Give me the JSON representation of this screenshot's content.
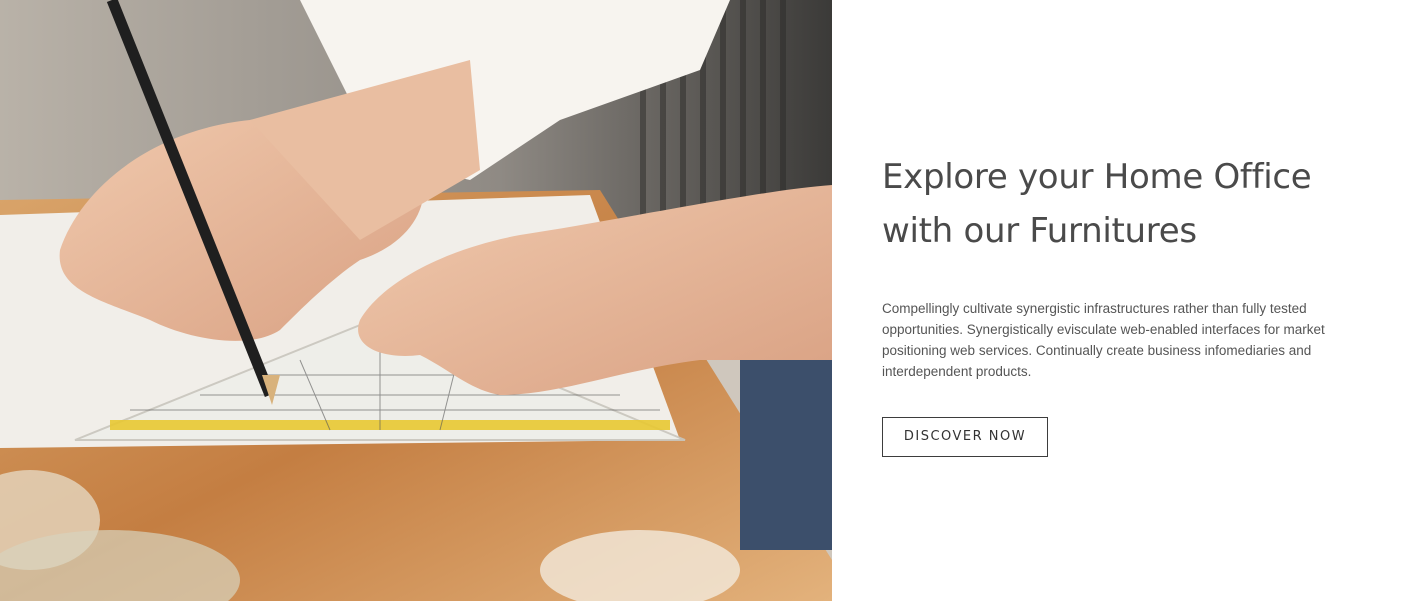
{
  "hero": {
    "image_alt": "Hands drawing with a pencil and a set square on a wooden desk",
    "headline": "Explore your Home Office with our Furnitures",
    "description": "Compellingly cultivate synergistic infrastructures rather than fully tested opportunities. Synergistically evisculate web-enabled interfaces for market positioning web services. Continually create business infomediaries and interdependent products.",
    "cta_label": "DISCOVER NOW"
  },
  "colors": {
    "headline": "#4a4a4a",
    "body_text": "#555555",
    "button_border": "#3d3d3d",
    "background": "#ffffff",
    "desk_wood": "#c98a4e",
    "ruler_yellow": "#e8c832"
  }
}
